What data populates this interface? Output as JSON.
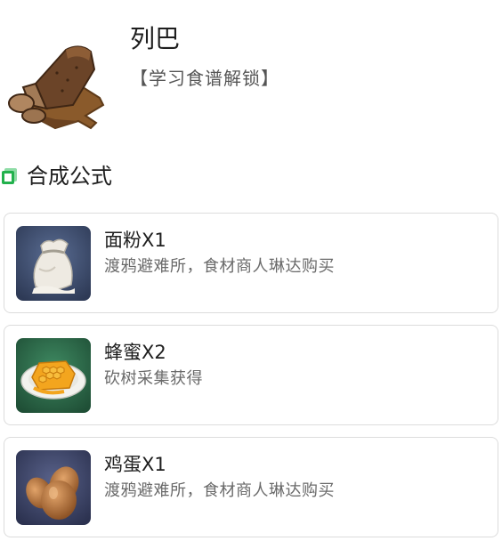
{
  "item": {
    "name": "列巴",
    "unlock": "【学习食谱解锁】",
    "icon": "rye-bread-loaf-icon"
  },
  "section": {
    "title": "合成公式",
    "icon": "section-marker-icon",
    "accent_color": "#22b14c"
  },
  "ingredients": [
    {
      "name": "面粉X1",
      "source": "渡鸦避难所，食材商人琳达购买",
      "icon": "flour-sack-icon",
      "thumb_bg": "#3c4c6e"
    },
    {
      "name": "蜂蜜X2",
      "source": "砍树采集获得",
      "icon": "honeycomb-plate-icon",
      "thumb_bg": "#2f6e4e"
    },
    {
      "name": "鸡蛋X1",
      "source": "渡鸦避难所，食材商人琳达购买",
      "icon": "eggs-icon",
      "thumb_bg": "#3d4566"
    }
  ]
}
